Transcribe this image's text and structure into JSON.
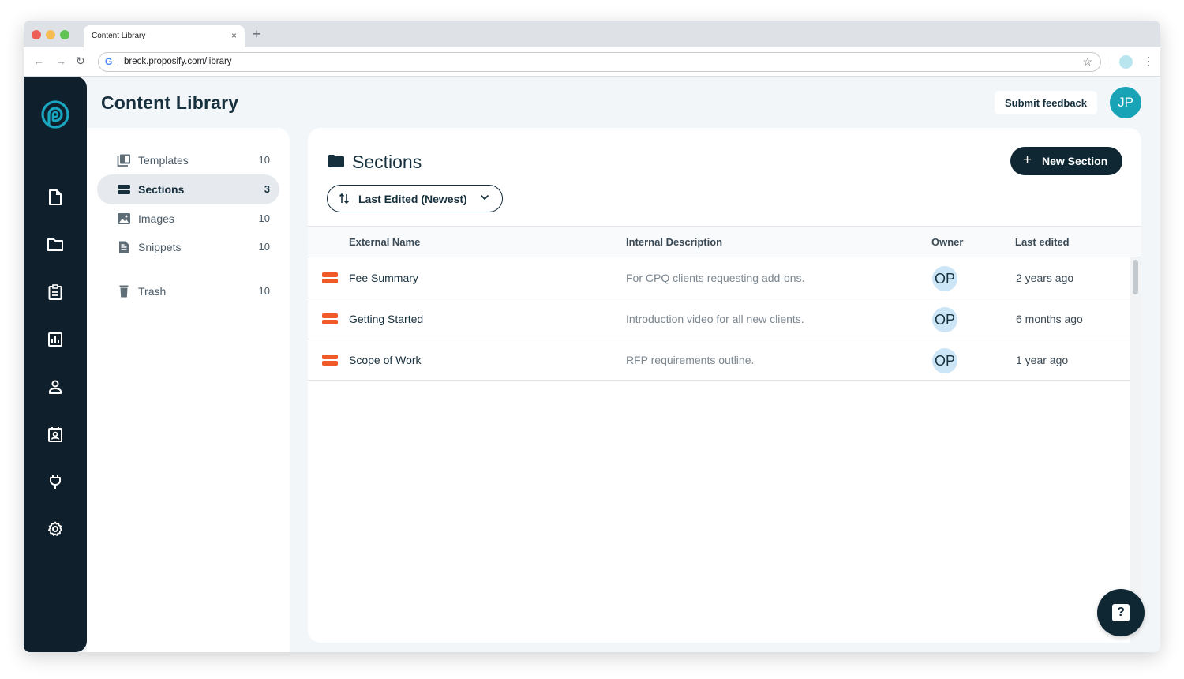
{
  "browser": {
    "tab_title": "Content Library",
    "tab_close": "×",
    "new_tab": "+",
    "url": "breck.proposify.com/library"
  },
  "header": {
    "title": "Content Library",
    "feedback_label": "Submit feedback",
    "user_initials": "JP"
  },
  "rail": {
    "items": [
      "documents",
      "folders",
      "clipboard",
      "reports",
      "contacts",
      "contact-card",
      "integrations",
      "settings"
    ]
  },
  "library_nav": {
    "items": [
      {
        "label": "Templates",
        "count": "10",
        "icon": "templates-icon"
      },
      {
        "label": "Sections",
        "count": "3",
        "icon": "sections-icon",
        "active": true
      },
      {
        "label": "Images",
        "count": "10",
        "icon": "image-icon"
      },
      {
        "label": "Snippets",
        "count": "10",
        "icon": "snippet-icon"
      },
      {
        "label": "Trash",
        "count": "10",
        "icon": "trash-icon"
      }
    ]
  },
  "panel": {
    "title": "Sections",
    "new_button": "New Section",
    "new_button_icon": "+",
    "sort_label": "Last Edited (Newest)",
    "columns": [
      "External Name",
      "Internal Description",
      "Owner",
      "Last edited"
    ],
    "rows": [
      {
        "name": "Fee Summary",
        "description": "For CPQ clients requesting add-ons.",
        "owner": "OP",
        "edited": "2 years ago"
      },
      {
        "name": "Getting Started",
        "description": "Introduction video for all new clients.",
        "owner": "OP",
        "edited": "6 months ago"
      },
      {
        "name": "Scope of Work",
        "description": "RFP requirements outline.",
        "owner": "OP",
        "edited": "1 year ago"
      }
    ]
  },
  "help": {
    "label": "?"
  },
  "colors": {
    "rail": "#0f1f2c",
    "accent_teal": "#18a3b7",
    "section_orange": "#f05a28",
    "primary_dark": "#0f2733"
  }
}
